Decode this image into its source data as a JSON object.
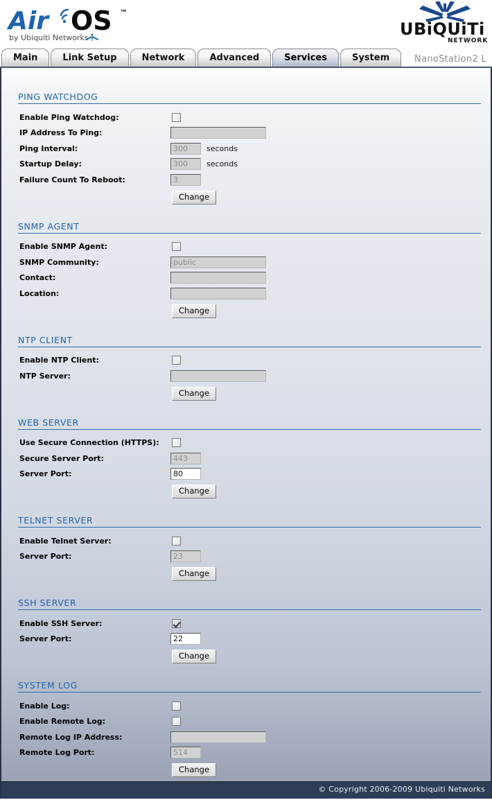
{
  "header": {
    "product_logo": "AirOS",
    "product_logo_tm": "™",
    "product_byline": "by Ubiquiti Networks",
    "brand_name": "UBIQUITI",
    "brand_sub": "NETWORKS",
    "device_name": "NanoStation2 L"
  },
  "tabs": [
    {
      "label": "Main",
      "active": false
    },
    {
      "label": "Link Setup",
      "active": false
    },
    {
      "label": "Network",
      "active": false
    },
    {
      "label": "Advanced",
      "active": false
    },
    {
      "label": "Services",
      "active": true
    },
    {
      "label": "System",
      "active": false
    }
  ],
  "buttons": {
    "change": "Change"
  },
  "sections": {
    "ping_watchdog": {
      "title": "PING WATCHDOG",
      "enable_label": "Enable Ping Watchdog:",
      "enable_checked": false,
      "ip_label": "IP Address To Ping:",
      "ip_value": "",
      "interval_label": "Ping Interval:",
      "interval_value": "300",
      "interval_unit": "seconds",
      "startup_label": "Startup Delay:",
      "startup_value": "300",
      "startup_unit": "seconds",
      "failure_label": "Failure Count To Reboot:",
      "failure_value": "3"
    },
    "snmp_agent": {
      "title": "SNMP AGENT",
      "enable_label": "Enable SNMP Agent:",
      "enable_checked": false,
      "community_label": "SNMP Community:",
      "community_value": "public",
      "contact_label": "Contact:",
      "contact_value": "",
      "location_label": "Location:",
      "location_value": ""
    },
    "ntp_client": {
      "title": "NTP CLIENT",
      "enable_label": "Enable NTP Client:",
      "enable_checked": false,
      "server_label": "NTP Server:",
      "server_value": ""
    },
    "web_server": {
      "title": "WEB SERVER",
      "https_label": "Use Secure Connection (HTTPS):",
      "https_checked": false,
      "secure_port_label": "Secure Server Port:",
      "secure_port_value": "443",
      "port_label": "Server Port:",
      "port_value": "80"
    },
    "telnet_server": {
      "title": "TELNET SERVER",
      "enable_label": "Enable Telnet Server:",
      "enable_checked": false,
      "port_label": "Server Port:",
      "port_value": "23"
    },
    "ssh_server": {
      "title": "SSH SERVER",
      "enable_label": "Enable SSH Server:",
      "enable_checked": true,
      "port_label": "Server Port:",
      "port_value": "22"
    },
    "system_log": {
      "title": "SYSTEM LOG",
      "enable_label": "Enable Log:",
      "enable_checked": false,
      "remote_label": "Enable Remote Log:",
      "remote_checked": false,
      "remote_ip_label": "Remote Log IP Address:",
      "remote_ip_value": "",
      "remote_port_label": "Remote Log Port:",
      "remote_port_value": "514"
    }
  },
  "footer": {
    "copyright": "© Copyright 2006-2009 Ubiquiti Networks"
  },
  "colors": {
    "accent_blue": "#1e62ad",
    "rule_blue": "#2c6bb0",
    "footer_bg": "#2d3e56",
    "frame_border": "#2b3246"
  }
}
